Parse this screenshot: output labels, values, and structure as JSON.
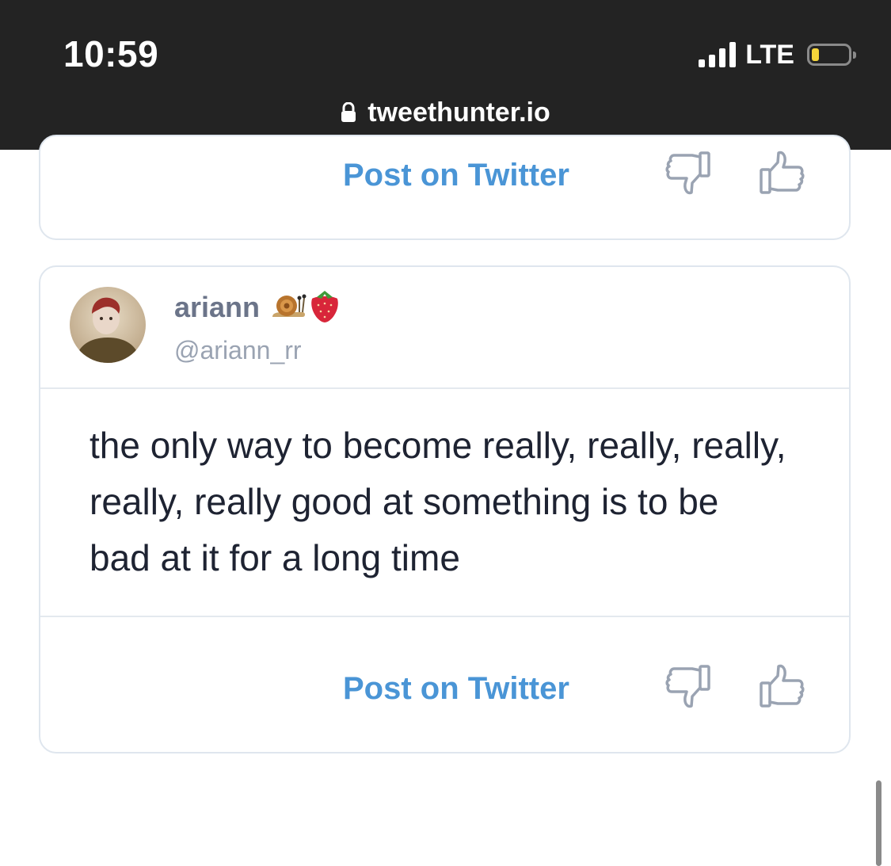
{
  "status_bar": {
    "time": "10:59",
    "network": "LTE",
    "battery_level": 0.2,
    "battery_color": "#f5d53a"
  },
  "browser": {
    "url": "tweethunter.io",
    "lock_icon": "lock-icon"
  },
  "colors": {
    "accent": "#4a95d6",
    "icon_gray": "#9aa3b2",
    "topbar": "#232323"
  },
  "cards": [
    {
      "actions": {
        "post_label": "Post on Twitter",
        "dislike_icon": "thumbs-down-icon",
        "like_icon": "thumbs-up-icon"
      }
    },
    {
      "author": {
        "display_name": "ariann",
        "emoji": [
          "snail-emoji",
          "strawberry-emoji"
        ],
        "handle": "@ariann_rr"
      },
      "text": "the only way to become really, really, really, really, really good at something is to be bad at it for a long time",
      "actions": {
        "post_label": "Post on Twitter",
        "dislike_icon": "thumbs-down-icon",
        "like_icon": "thumbs-up-icon"
      }
    }
  ]
}
